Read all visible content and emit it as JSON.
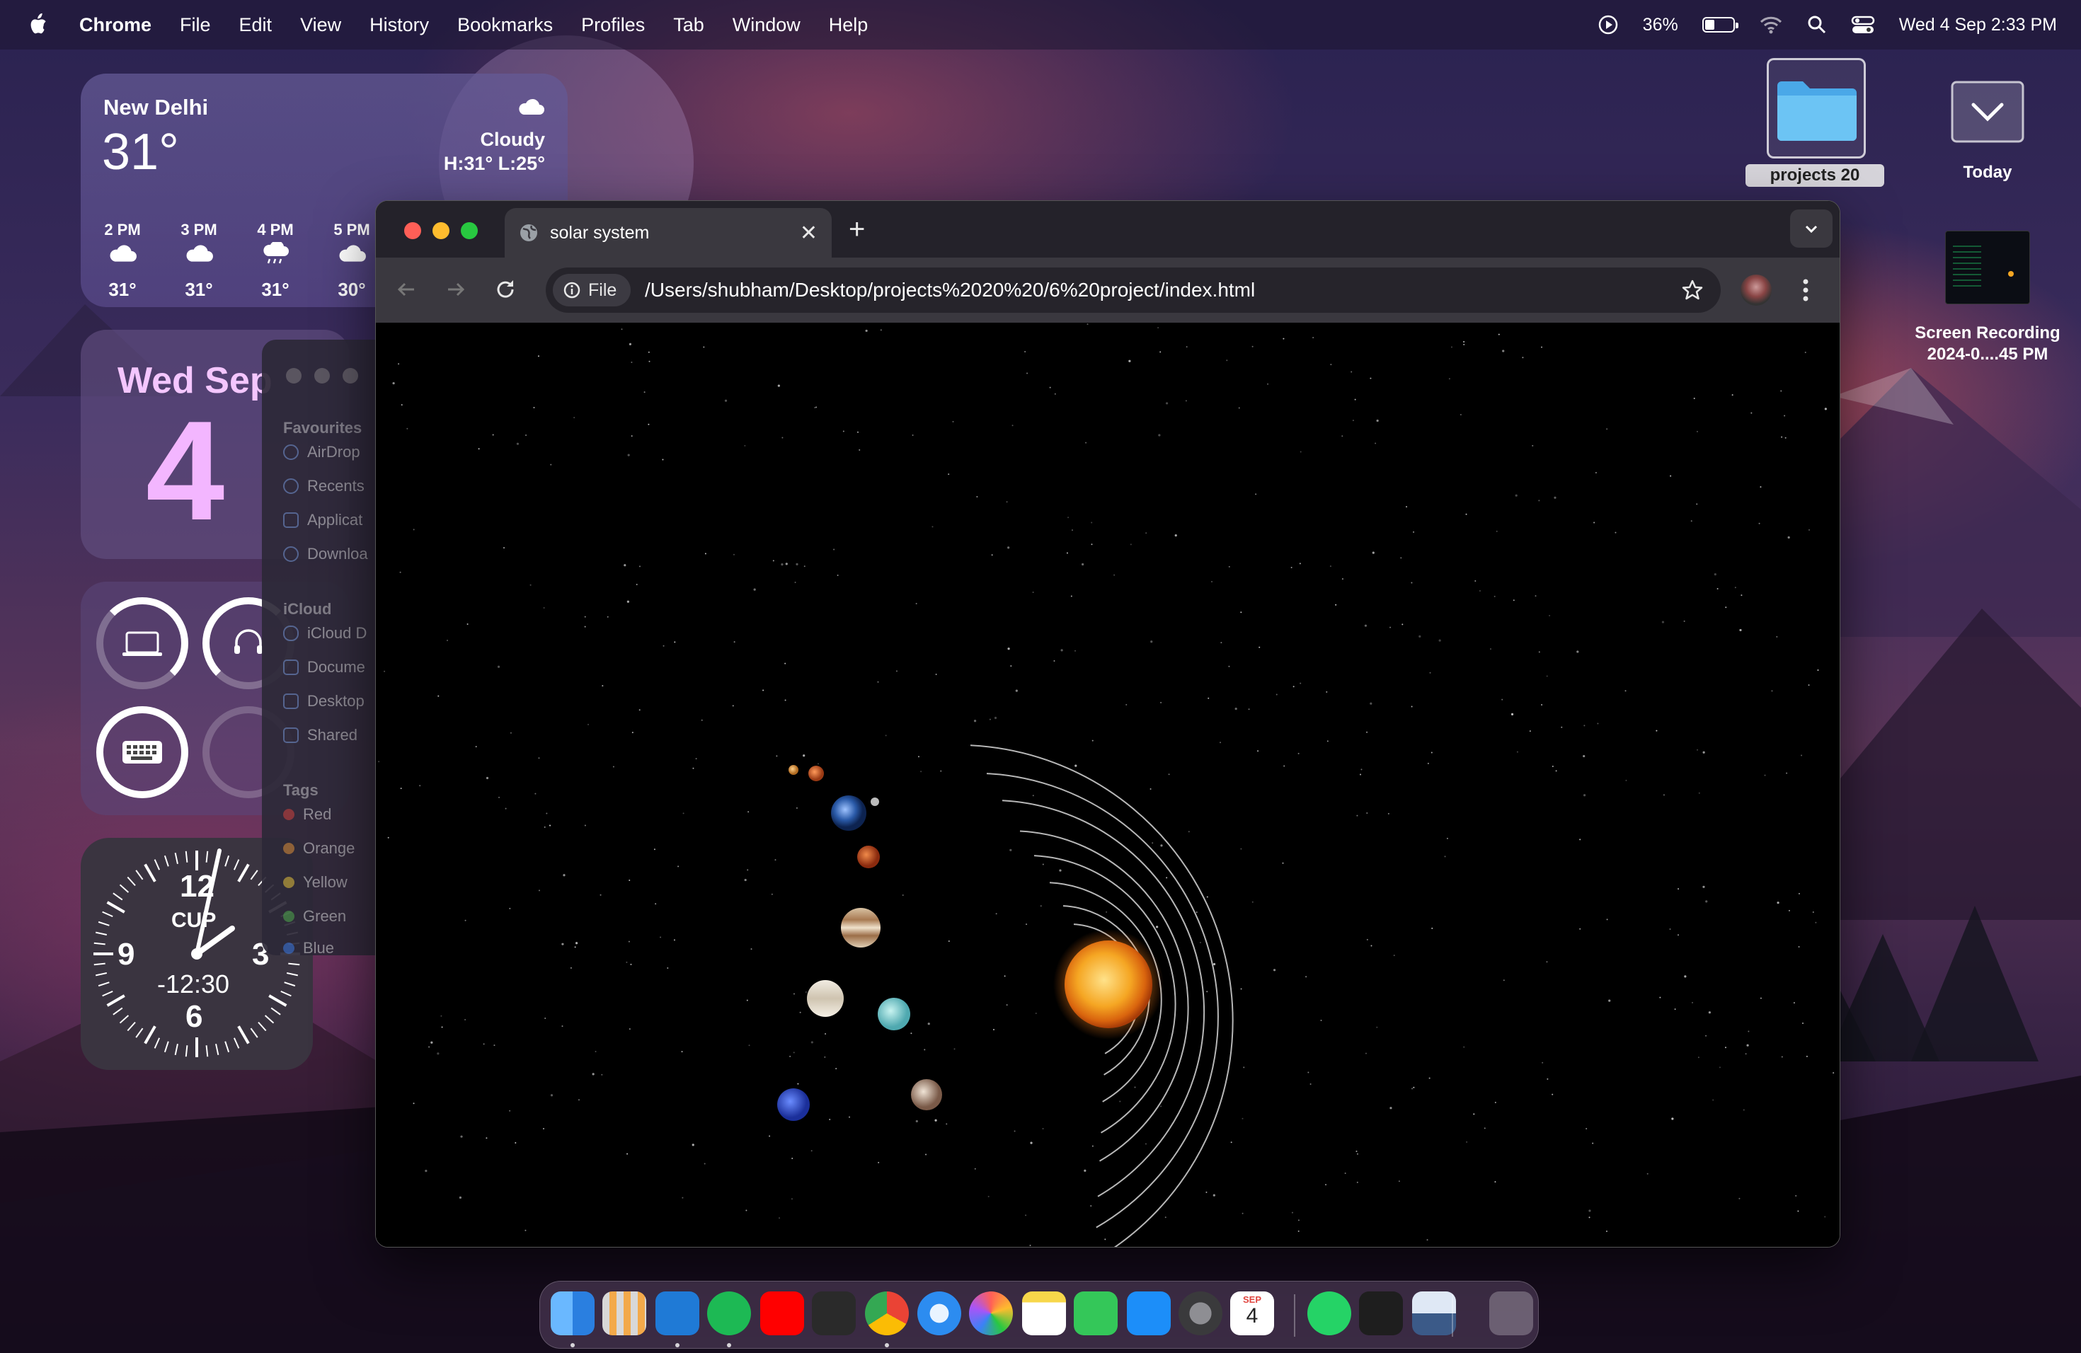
{
  "menubar": {
    "app_name": "Chrome",
    "items": [
      "File",
      "Edit",
      "View",
      "History",
      "Bookmarks",
      "Profiles",
      "Tab",
      "Window",
      "Help"
    ],
    "battery_percent": "36%",
    "battery_level": 0.36,
    "datetime": "Wed 4 Sep  2:33 PM"
  },
  "weather": {
    "city": "New Delhi",
    "temp": "31°",
    "condition": "Cloudy",
    "hilo": "H:31° L:25°",
    "hours": [
      {
        "time": "2 PM",
        "temp": "31°",
        "icon": "cloud-icon"
      },
      {
        "time": "3 PM",
        "temp": "31°",
        "icon": "cloud-icon"
      },
      {
        "time": "4 PM",
        "temp": "31°",
        "icon": "rain-cloud-icon"
      },
      {
        "time": "5 PM",
        "temp": "30°",
        "icon": "cloud-icon"
      }
    ]
  },
  "calendar": {
    "day": "Wed Sep",
    "date": "4"
  },
  "clock": {
    "label_city": "CUP",
    "offset": "-12:30",
    "n12": "12",
    "n3": "3",
    "n6": "6",
    "n9": "9"
  },
  "desktop": {
    "folder_name": "projects 20",
    "stack_label": "Today",
    "recording_name_1": "Screen Recording",
    "recording_name_2": "2024-0....45 PM"
  },
  "finder": {
    "favourites_label": "Favourites",
    "favourites": [
      "AirDrop",
      "Recents",
      "Applicat",
      "Downloa"
    ],
    "icloud_label": "iCloud",
    "icloud": [
      "iCloud D",
      "Docume",
      "Desktop",
      "Shared"
    ],
    "tags_label": "Tags",
    "tags": [
      {
        "name": "Red",
        "color": "#e0443e"
      },
      {
        "name": "Orange",
        "color": "#f09a37"
      },
      {
        "name": "Yellow",
        "color": "#f5cf3a"
      },
      {
        "name": "Green",
        "color": "#52b84e"
      },
      {
        "name": "Blue",
        "color": "#3b82f6"
      }
    ]
  },
  "browser": {
    "tab_title": "solar system",
    "close_symbol": "✕",
    "new_tab_symbol": "+",
    "chip_label": "File",
    "url": "/Users/shubham/Desktop/projects%2020%20/6%20project/index.html"
  },
  "dock": {
    "apps": [
      "Finder",
      "Launchpad",
      "Visual Studio Code",
      "Spotify",
      "YouTube",
      "Keyboard",
      "Google Chrome",
      "Safari",
      "Photos",
      "Notes",
      "FaceTime",
      "App Store",
      "System Settings",
      "Calendar",
      "WhatsApp",
      "Mercury",
      "Preview",
      "Trash"
    ],
    "calendar_month": "SEP",
    "calendar_day": "4"
  },
  "colors": {
    "sun": "#f5a623",
    "orbit": "#d8d8d8",
    "traffic_red": "#ff5f57",
    "traffic_yellow": "#febc2e",
    "traffic_green": "#28c840"
  }
}
